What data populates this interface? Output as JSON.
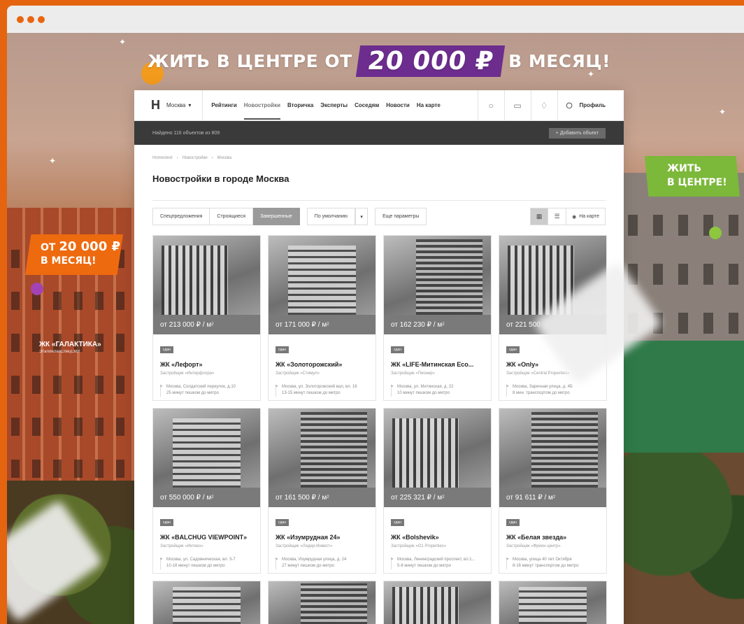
{
  "promo": {
    "lead": "ЖИТЬ В ЦЕНТРЕ ОТ",
    "price": "20 000 ₽",
    "tail": "В МЕСЯЦ!"
  },
  "badge_left": {
    "line1_prefix": "ОТ",
    "line1_price": "20 000 ₽",
    "line2": "В МЕСЯЦ!"
  },
  "badge_right": {
    "line1": "ЖИТЬ",
    "line2": "В ЦЕНТРЕ!"
  },
  "side_caption": {
    "title": "ЖК «ГАЛАКТИКА»",
    "subtitle": "ЭталонЛенСпецСМУ"
  },
  "colors": {
    "accent_orange": "#ee6a0f",
    "promo_purple": "#6d2d8e",
    "accent_green": "#7cb83a",
    "dark_bar": "#3a3a3a"
  },
  "header": {
    "logo": "Н",
    "city": "Москва",
    "nav": [
      "Рейтинги",
      "Новостройки",
      "Вторичка",
      "Эксперты",
      "Соседям",
      "Новости",
      "На карте"
    ],
    "active_nav": "Новостройки",
    "icons": [
      "search-icon",
      "chat-icon",
      "bell-icon",
      "user-icon"
    ],
    "profile": "Профиль"
  },
  "status": {
    "found": "Найдено 116 объектов из 809",
    "add_button": "+ Добавить объект"
  },
  "breadcrumbs": [
    "Homestest",
    "Новостройки",
    "Москва"
  ],
  "page_title": "Новостройки в городе Москва",
  "filters": {
    "tabs": [
      "Спецпредложения",
      "Строящиеся",
      "Завершенные"
    ],
    "active_tab": "Завершенные",
    "sort": "По умолчанию",
    "more": "Еще параметры",
    "map": "На карте"
  },
  "cards": [
    {
      "price": "от 213 000 ₽ / м",
      "tag": "сдан",
      "name": "ЖК «Лефорт»",
      "dev": "Застройщик «Интерфлора»",
      "addr": "Москва, Солдатский переулок, д.10",
      "transit": "25 минут пешком до метро"
    },
    {
      "price": "от 171 000 ₽ / м",
      "tag": "сдан",
      "name": "ЖК «Золоторожский»",
      "dev": "Застройщик «Стимул»",
      "addr": "Москва, ул. Золоторожский вал, вл. 16",
      "transit": "13-15 минут пешком до метро"
    },
    {
      "price": "от 162 230 ₽ / м",
      "tag": "сдан",
      "name": "ЖК «LIFE-Митинская Есо...",
      "dev": "Застройщик «Пионер»",
      "addr": "Москва, ул. Митинская, д. 22",
      "transit": "10 минут пешком до метро"
    },
    {
      "price": "от 221 500",
      "tag": "сдан",
      "name": "ЖК «Only»",
      "dev": "Застройщик «Central Properties»",
      "addr": "Москва, Заречная улица, д. 4Б",
      "transit": "8 мин. транспортом до метро"
    },
    {
      "price": "от 550 000 ₽ / м",
      "tag": "сдан",
      "name": "ЖК «BALCHUG VIEWPOINT»",
      "dev": "Застройщик «Интеко»",
      "addr": "Москва, ул. Садовническая, вл. 3-7",
      "transit": "10-18 минут пешком до метро"
    },
    {
      "price": "от 161 500 ₽ / м",
      "tag": "сдан",
      "name": "ЖК «Изумрудная 24»",
      "dev": "Застройщик «Лидер-Инвест»",
      "addr": "Москва, Изумрудная улица, д. 24",
      "transit": "27 минут пешком до метро"
    },
    {
      "price": "от 225 321 ₽ / м",
      "tag": "сдан",
      "name": "ЖК «Bolshevik»",
      "dev": "Застройщик «О1 Properties»",
      "addr": "Москва, Ленинградский проспект, вл.1...",
      "transit": "5-8 минут пешком до метро"
    },
    {
      "price": "от 91 611 ₽ / м",
      "tag": "сдан",
      "name": "ЖК «Белая звезда»",
      "dev": "Застройщик «Фрион центр»",
      "addr": "Москва, улица 40 лет Октября",
      "transit": "8-16 минут транспортом до метро"
    }
  ]
}
